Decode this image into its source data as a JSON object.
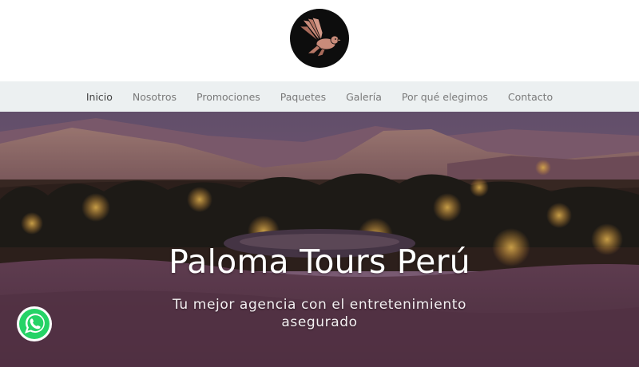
{
  "header": {
    "logo_icon": "dove-bird-logo",
    "logo_bg": "#0d0d0d",
    "logo_color": "#c98b7a"
  },
  "nav": {
    "items": [
      {
        "label": "Inicio",
        "active": true
      },
      {
        "label": "Nosotros"
      },
      {
        "label": "Promociones"
      },
      {
        "label": "Paquetes"
      },
      {
        "label": "Galería"
      },
      {
        "label": "Por qué elegimos"
      },
      {
        "label": "Contacto"
      }
    ],
    "bg_color": "#ecf0f1"
  },
  "hero": {
    "title": "Paloma Tours Perú",
    "subtitle": "Tu mejor agencia con el entretenimiento asegurado"
  },
  "whatsapp": {
    "icon": "whatsapp-icon",
    "color": "#25d366"
  }
}
